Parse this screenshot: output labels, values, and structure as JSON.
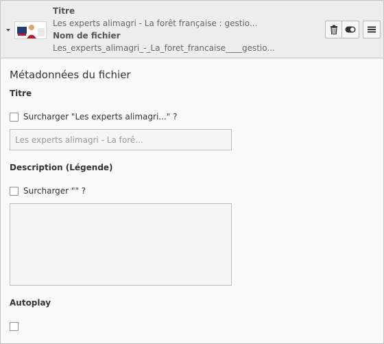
{
  "header": {
    "title_label": "Titre",
    "title_value": "Les experts alimagri - La forêt française : gestio...",
    "filename_label": "Nom de fichier",
    "filename_value": "Les_experts_alimagri_-_La_foret_francaise____gestio..."
  },
  "toolbar": {
    "icons": [
      "caret-down-icon",
      "trash-icon",
      "toggle-icon",
      "menu-icon"
    ]
  },
  "form": {
    "section_title": "Métadonnées du fichier",
    "title_field": {
      "label": "Titre",
      "override_label": "Surcharger \"Les experts alimagri...\" ?",
      "placeholder": "Les experts alimagri - La forê..."
    },
    "description_field": {
      "label": "Description (Légende)",
      "override_label": "Surcharger \"\" ?",
      "value": ""
    },
    "autoplay_field": {
      "label": "Autoplay"
    }
  },
  "colors": {
    "header_bg": "#ededed",
    "panel_bg": "#fafafa",
    "border": "#c3c3c3",
    "input_bg": "#f5f5f5"
  }
}
